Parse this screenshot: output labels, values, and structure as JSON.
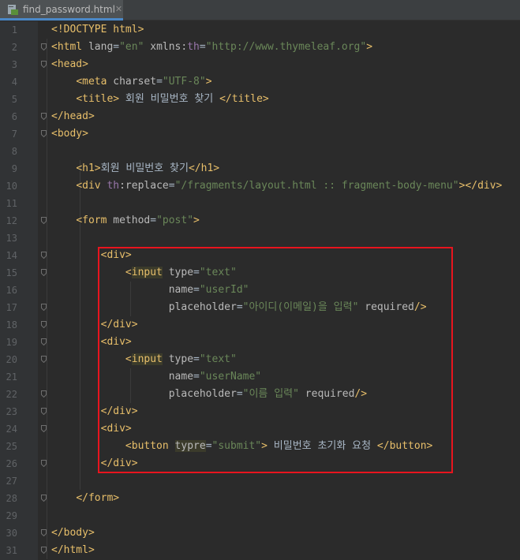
{
  "tab": {
    "file_name": "find_password.html",
    "close_glyph": "✕",
    "icon": "html-file-icon"
  },
  "lines": [
    {
      "n": "1",
      "parts": [
        [
          "tag",
          "<!DOCTYPE html>"
        ]
      ]
    },
    {
      "n": "2",
      "parts": [
        [
          "tag",
          "<html "
        ],
        [
          "attr",
          "lang"
        ],
        [
          "txt",
          "="
        ],
        [
          "val",
          "\"en\""
        ],
        [
          "txt",
          " "
        ],
        [
          "attr",
          "xmlns:"
        ],
        [
          "ns",
          "th"
        ],
        [
          "txt",
          "="
        ],
        [
          "val",
          "\"http://www.thymeleaf.org\""
        ],
        [
          "tag",
          ">"
        ]
      ]
    },
    {
      "n": "3",
      "parts": [
        [
          "tag",
          "<head>"
        ]
      ]
    },
    {
      "n": "4",
      "parts": [
        [
          "txt",
          "    "
        ],
        [
          "tag",
          "<meta "
        ],
        [
          "attr",
          "charset"
        ],
        [
          "txt",
          "="
        ],
        [
          "val",
          "\"UTF-8\""
        ],
        [
          "tag",
          ">"
        ]
      ]
    },
    {
      "n": "5",
      "parts": [
        [
          "txt",
          "    "
        ],
        [
          "tag",
          "<title>"
        ],
        [
          "txt",
          " 회원 비밀번호 찾기 "
        ],
        [
          "tag",
          "</title>"
        ]
      ]
    },
    {
      "n": "6",
      "parts": [
        [
          "tag",
          "</head>"
        ]
      ]
    },
    {
      "n": "7",
      "parts": [
        [
          "tag",
          "<body>"
        ]
      ]
    },
    {
      "n": "8",
      "parts": []
    },
    {
      "n": "9",
      "parts": [
        [
          "txt",
          "    "
        ],
        [
          "tag",
          "<h1>"
        ],
        [
          "txt",
          "회원 비밀번호 찾기"
        ],
        [
          "tag",
          "</h1>"
        ]
      ]
    },
    {
      "n": "10",
      "parts": [
        [
          "txt",
          "    "
        ],
        [
          "tag",
          "<div "
        ],
        [
          "ns",
          "th"
        ],
        [
          "attr",
          ":replace"
        ],
        [
          "txt",
          "="
        ],
        [
          "val",
          "\"/fragments/layout.html :: fragment-body-menu\""
        ],
        [
          "tag",
          "></div>"
        ]
      ]
    },
    {
      "n": "11",
      "parts": []
    },
    {
      "n": "12",
      "parts": [
        [
          "txt",
          "    "
        ],
        [
          "tag",
          "<form "
        ],
        [
          "attr",
          "method"
        ],
        [
          "txt",
          "="
        ],
        [
          "val",
          "\"post\""
        ],
        [
          "tag",
          ">"
        ]
      ]
    },
    {
      "n": "13",
      "parts": []
    },
    {
      "n": "14",
      "parts": [
        [
          "txt",
          "        "
        ],
        [
          "tag",
          "<div>"
        ]
      ]
    },
    {
      "n": "15",
      "parts": [
        [
          "txt",
          "            "
        ],
        [
          "tag",
          "<"
        ],
        [
          "tag hl",
          "input"
        ],
        [
          "txt",
          " "
        ],
        [
          "attr",
          "type"
        ],
        [
          "txt",
          "="
        ],
        [
          "val",
          "\"text\""
        ]
      ]
    },
    {
      "n": "16",
      "parts": [
        [
          "txt",
          "                   "
        ],
        [
          "attr",
          "name"
        ],
        [
          "txt",
          "="
        ],
        [
          "val",
          "\"userId\""
        ]
      ]
    },
    {
      "n": "17",
      "parts": [
        [
          "txt",
          "                   "
        ],
        [
          "attr",
          "placeholder"
        ],
        [
          "txt",
          "="
        ],
        [
          "val",
          "\"아이디(이메일)을 입력\""
        ],
        [
          "txt",
          " "
        ],
        [
          "attr",
          "required"
        ],
        [
          "tag",
          "/>"
        ]
      ]
    },
    {
      "n": "18",
      "parts": [
        [
          "txt",
          "        "
        ],
        [
          "tag",
          "</div>"
        ]
      ]
    },
    {
      "n": "19",
      "parts": [
        [
          "txt",
          "        "
        ],
        [
          "tag",
          "<div>"
        ]
      ]
    },
    {
      "n": "20",
      "parts": [
        [
          "txt",
          "            "
        ],
        [
          "tag",
          "<"
        ],
        [
          "tag hl",
          "input"
        ],
        [
          "txt",
          " "
        ],
        [
          "attr",
          "type"
        ],
        [
          "txt",
          "="
        ],
        [
          "val",
          "\"text\""
        ]
      ]
    },
    {
      "n": "21",
      "parts": [
        [
          "txt",
          "                   "
        ],
        [
          "attr",
          "name"
        ],
        [
          "txt",
          "="
        ],
        [
          "val",
          "\"userName\""
        ]
      ]
    },
    {
      "n": "22",
      "parts": [
        [
          "txt",
          "                   "
        ],
        [
          "attr",
          "placeholder"
        ],
        [
          "txt",
          "="
        ],
        [
          "val",
          "\"이름 입력\""
        ],
        [
          "txt",
          " "
        ],
        [
          "attr",
          "required"
        ],
        [
          "tag",
          "/>"
        ]
      ]
    },
    {
      "n": "23",
      "parts": [
        [
          "txt",
          "        "
        ],
        [
          "tag",
          "</div>"
        ]
      ]
    },
    {
      "n": "24",
      "parts": [
        [
          "txt",
          "        "
        ],
        [
          "tag",
          "<div>"
        ]
      ]
    },
    {
      "n": "25",
      "parts": [
        [
          "txt",
          "            "
        ],
        [
          "tag",
          "<button "
        ],
        [
          "attr hl",
          "typre"
        ],
        [
          "txt",
          "="
        ],
        [
          "val",
          "\"submit\""
        ],
        [
          "tag",
          ">"
        ],
        [
          "txt",
          " 비밀번호 초기화 요청 "
        ],
        [
          "tag",
          "</button>"
        ]
      ]
    },
    {
      "n": "26",
      "parts": [
        [
          "txt",
          "        "
        ],
        [
          "tag",
          "</div>"
        ]
      ]
    },
    {
      "n": "27",
      "parts": []
    },
    {
      "n": "28",
      "parts": [
        [
          "txt",
          "    "
        ],
        [
          "tag",
          "</form>"
        ]
      ]
    },
    {
      "n": "29",
      "parts": []
    },
    {
      "n": "30",
      "parts": [
        [
          "tag",
          "</body>"
        ]
      ]
    },
    {
      "n": "31",
      "parts": [
        [
          "tag",
          "</html>"
        ]
      ]
    }
  ],
  "fold_lines": [
    "2",
    "3",
    "6",
    "7",
    "12",
    "14",
    "15",
    "17",
    "18",
    "19",
    "20",
    "22",
    "23",
    "24",
    "26",
    "28",
    "30",
    "31"
  ]
}
